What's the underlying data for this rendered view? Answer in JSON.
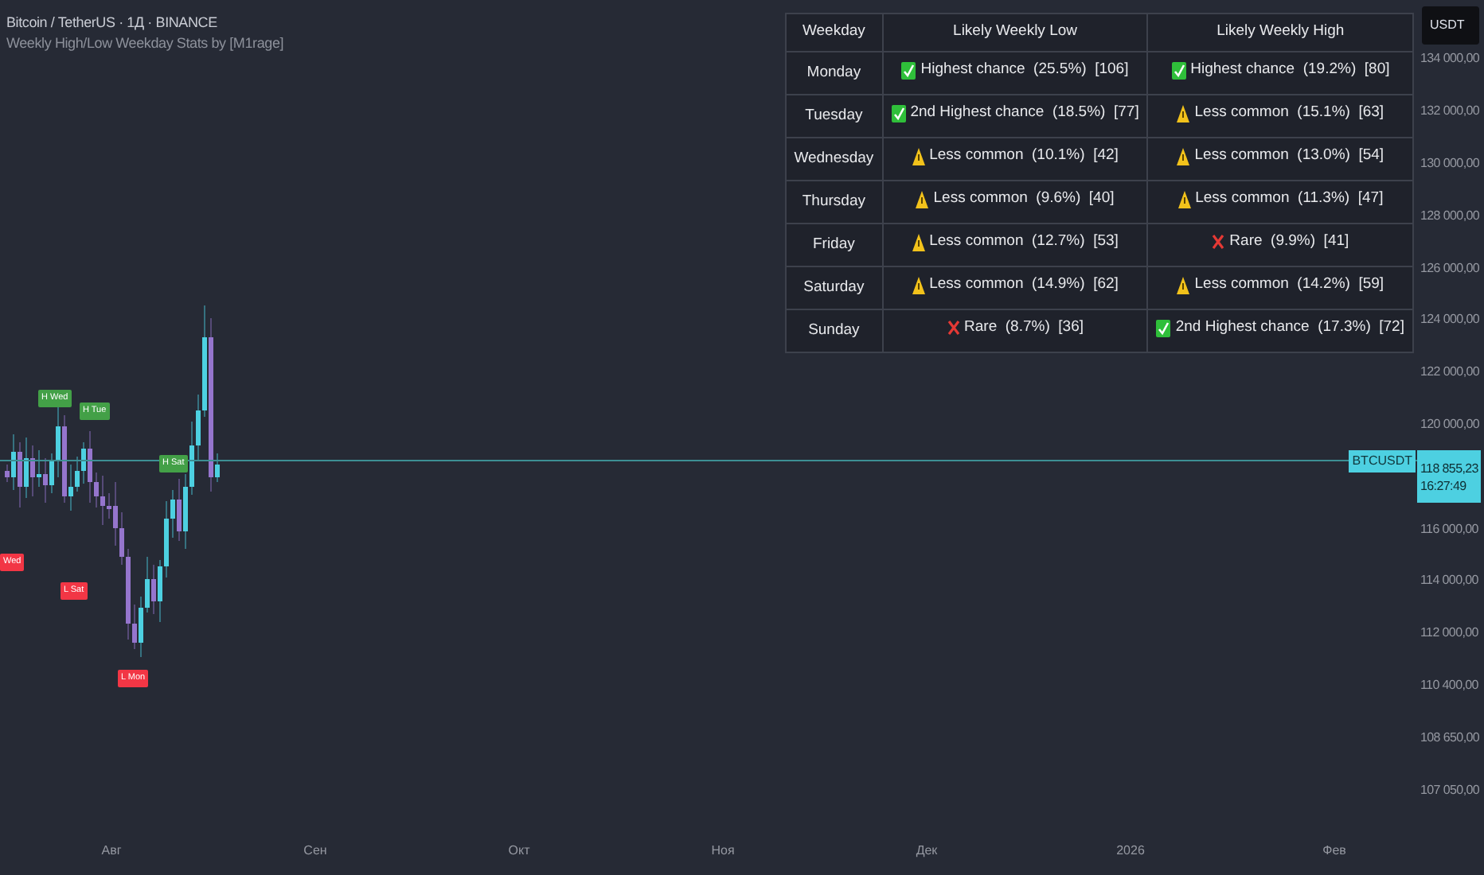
{
  "header": {
    "symbol": "Bitcoin / TetherUS · 1Д · BINANCE",
    "indicator": "Weekly High/Low Weekday Stats by [M1rage]"
  },
  "stats_table": {
    "columns": [
      "Weekday",
      "Likely Weekly Low",
      "Likely Weekly High"
    ],
    "rows": [
      {
        "weekday": "Monday",
        "low": {
          "kind": "check",
          "text": "Highest chance  (25.5%)  [106]"
        },
        "high": {
          "kind": "check",
          "text": "Highest chance  (19.2%)  [80]"
        }
      },
      {
        "weekday": "Tuesday",
        "low": {
          "kind": "check",
          "text": "2nd Highest chance  (18.5%)  [77]"
        },
        "high": {
          "kind": "warning",
          "text": "Less common  (15.1%)  [63]"
        }
      },
      {
        "weekday": "Wednesday",
        "low": {
          "kind": "warning",
          "text": "Less common  (10.1%)  [42]"
        },
        "high": {
          "kind": "warning",
          "text": "Less common  (13.0%)  [54]"
        }
      },
      {
        "weekday": "Thursday",
        "low": {
          "kind": "warning",
          "text": "Less common  (9.6%)  [40]"
        },
        "high": {
          "kind": "warning",
          "text": "Less common  (11.3%)  [47]"
        }
      },
      {
        "weekday": "Friday",
        "low": {
          "kind": "warning",
          "text": "Less common  (12.7%)  [53]"
        },
        "high": {
          "kind": "cross",
          "text": "Rare  (9.9%)  [41]"
        }
      },
      {
        "weekday": "Saturday",
        "low": {
          "kind": "warning",
          "text": "Less common  (14.9%)  [62]"
        },
        "high": {
          "kind": "warning",
          "text": "Less common  (14.2%)  [59]"
        }
      },
      {
        "weekday": "Sunday",
        "low": {
          "kind": "cross",
          "text": "Rare  (8.7%)  [36]"
        },
        "high": {
          "kind": "check",
          "text": "2nd Highest chance  (17.3%)  [72]"
        }
      }
    ]
  },
  "chart": {
    "markers": [
      {
        "kind": "high",
        "text": "H Wed"
      },
      {
        "kind": "high",
        "text": "H Tue"
      },
      {
        "kind": "high",
        "text": "H Sat"
      },
      {
        "kind": "low",
        "text": "Wed"
      },
      {
        "kind": "low",
        "text": "L Sat"
      },
      {
        "kind": "low",
        "text": "L Mon"
      }
    ],
    "symbol_tag": "BTCUSDT"
  },
  "price_axis": {
    "currency": "USDT",
    "items": [
      {
        "kind": "tick",
        "text": "134 000,00"
      },
      {
        "kind": "tick",
        "text": "132 000,00"
      },
      {
        "kind": "tick",
        "text": "130 000,00"
      },
      {
        "kind": "tick",
        "text": "128 000,00"
      },
      {
        "kind": "tick",
        "text": "126 000,00"
      },
      {
        "kind": "tick",
        "text": "124 000,00"
      },
      {
        "kind": "tick",
        "text": "122 000,00"
      },
      {
        "kind": "tick",
        "text": "120 000,00"
      },
      {
        "kind": "last_price",
        "price": "118 855,23",
        "countdown": "16:27:49"
      },
      {
        "kind": "tick",
        "text": "116 000,00"
      },
      {
        "kind": "tick",
        "text": "114 000,00"
      },
      {
        "kind": "tick",
        "text": "112 000,00"
      },
      {
        "kind": "tick",
        "text": "110 400,00"
      },
      {
        "kind": "tick",
        "text": "108 650,00"
      },
      {
        "kind": "tick",
        "text": "107 050,00"
      }
    ]
  },
  "time_axis": {
    "labels": [
      "Авг",
      "Сен",
      "Окт",
      "Ноя",
      "Дек",
      "2026",
      "Фев"
    ]
  }
}
